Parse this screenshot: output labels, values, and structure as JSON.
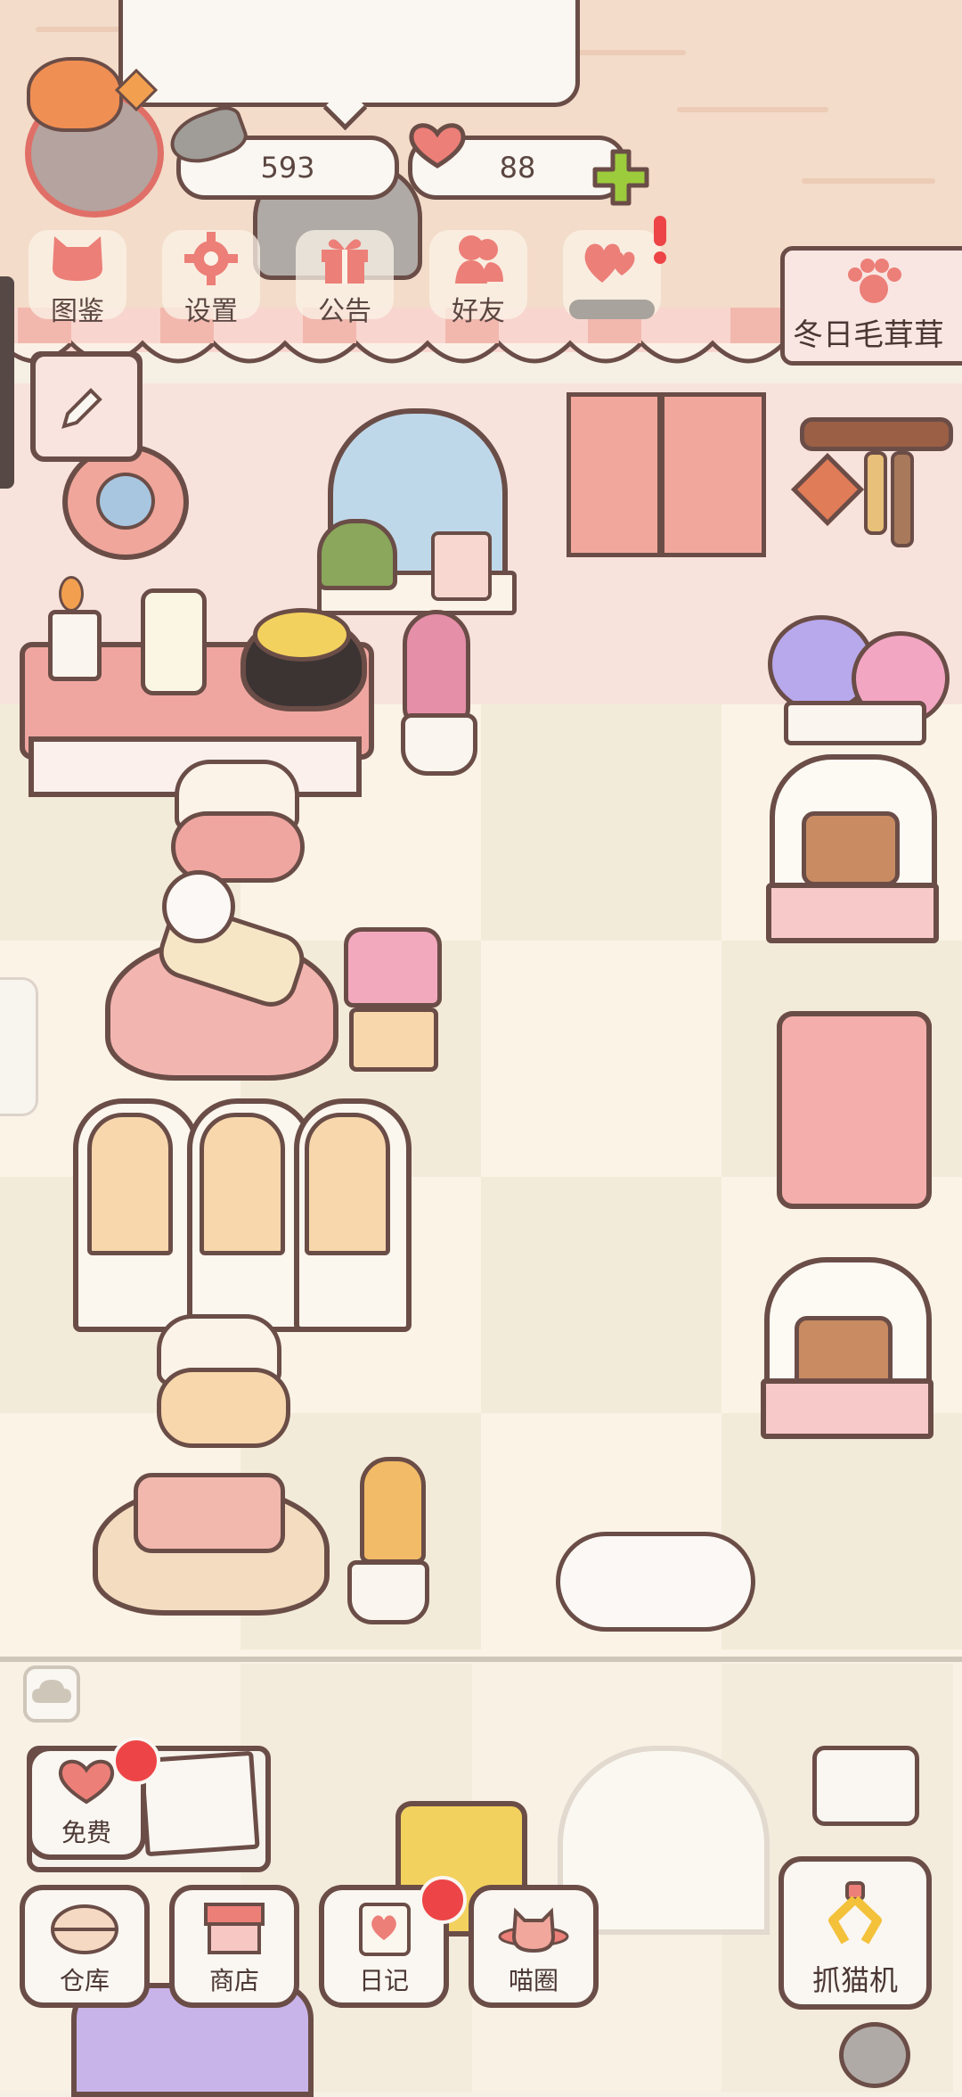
{
  "currency": {
    "fish": "593",
    "hearts": "88"
  },
  "top_menu": [
    {
      "label": "图鉴",
      "icon": "cat-head-icon"
    },
    {
      "label": "设置",
      "icon": "gear-icon"
    },
    {
      "label": "公告",
      "icon": "gift-icon"
    },
    {
      "label": "好友",
      "icon": "friends-icon"
    },
    {
      "label": "",
      "icon": "hearts-icon"
    }
  ],
  "event_banner": {
    "label": "冬日毛茸茸",
    "icon": "paw-icon"
  },
  "bottom_menu": {
    "free": "免费",
    "warehouse": "仓库",
    "shop": "商店",
    "diary": "日记",
    "meow_circle": "喵圈",
    "claw_machine": "抓猫机"
  },
  "colors": {
    "outline": "#6b4d47",
    "accent_pink": "#f0a6a0",
    "badge_red": "#ed4547",
    "plus_green": "#9ccc3c",
    "wall": "#f3dcc9",
    "floor": "#faf3e6"
  }
}
